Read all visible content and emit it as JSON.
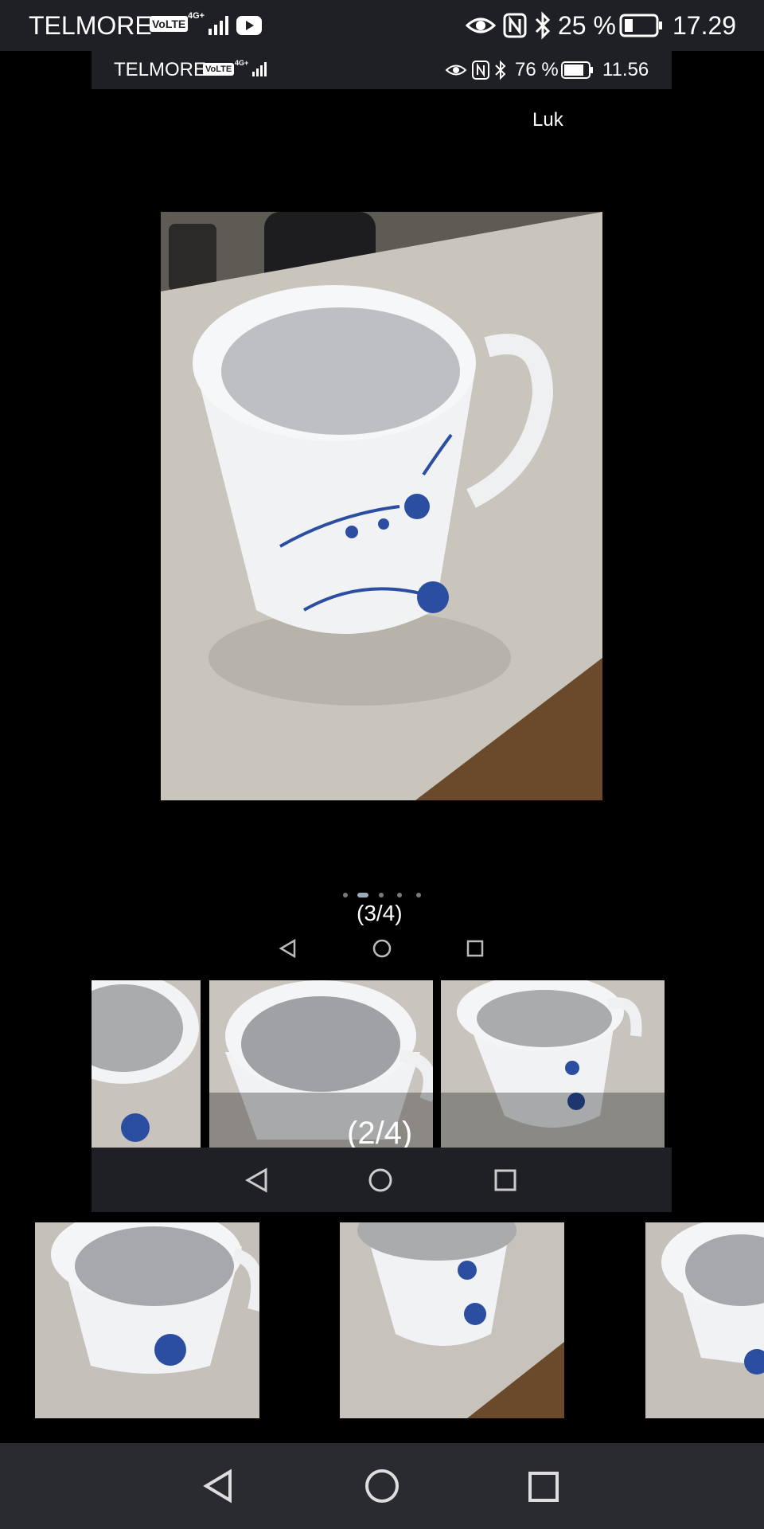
{
  "status_bar": {
    "carrier": "TELMORE",
    "volte": "VoLTE",
    "network": "4G+",
    "battery": "25 %",
    "time": "17.29"
  },
  "inner_status_bar": {
    "carrier": "TELMORE",
    "volte": "VoLTE",
    "network": "4G+",
    "battery": "76 %",
    "time": "11.56"
  },
  "viewer": {
    "close_label": "Luk",
    "counter": "(3/4)",
    "page_dots": 5,
    "active_dot": 1
  },
  "thumb_strip": {
    "counter": "(2/4)"
  },
  "nav": {
    "back": "back-icon",
    "home": "home-icon",
    "recents": "recents-icon"
  },
  "colors": {
    "bar_dark": "#1f2025",
    "nav_dark": "#2a2b30",
    "accent_dot": "#99aabb"
  }
}
